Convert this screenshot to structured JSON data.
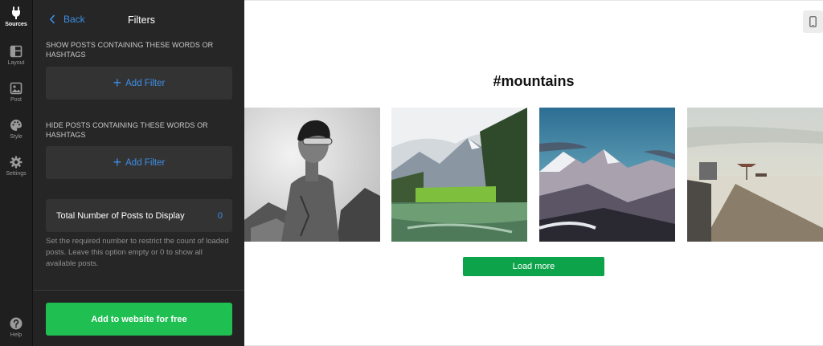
{
  "rail": {
    "items": [
      {
        "label": "Sources",
        "icon": "plug-icon",
        "active": true
      },
      {
        "label": "Layout",
        "icon": "layout-icon"
      },
      {
        "label": "Post",
        "icon": "image-icon"
      },
      {
        "label": "Style",
        "icon": "palette-icon"
      },
      {
        "label": "Settings",
        "icon": "gear-icon"
      }
    ],
    "help_label": "Help"
  },
  "panel": {
    "back_label": "Back",
    "title": "Filters",
    "show_section_label": "SHOW POSTS CONTAINING THESE WORDS OR HASHTAGS",
    "show_add_filter_label": "Add Filter",
    "hide_section_label": "HIDE POSTS CONTAINING THESE WORDS OR HASHTAGS",
    "hide_add_filter_label": "Add Filter",
    "total_label": "Total Number of Posts to Display",
    "total_value": "0",
    "hint": "Set the required number to restrict the count of loaded posts. Leave this option empty or 0 to show all available posts.",
    "cta_label": "Add to website for free"
  },
  "preview": {
    "feed_title": "#mountains",
    "load_more_label": "Load more",
    "device_icon": "mobile-icon"
  },
  "colors": {
    "accent": "#3d8fe6",
    "cta": "#1fbf52",
    "load_more": "#0da34a",
    "panel_bg": "#262626",
    "rail_bg": "#1f1f1f"
  }
}
